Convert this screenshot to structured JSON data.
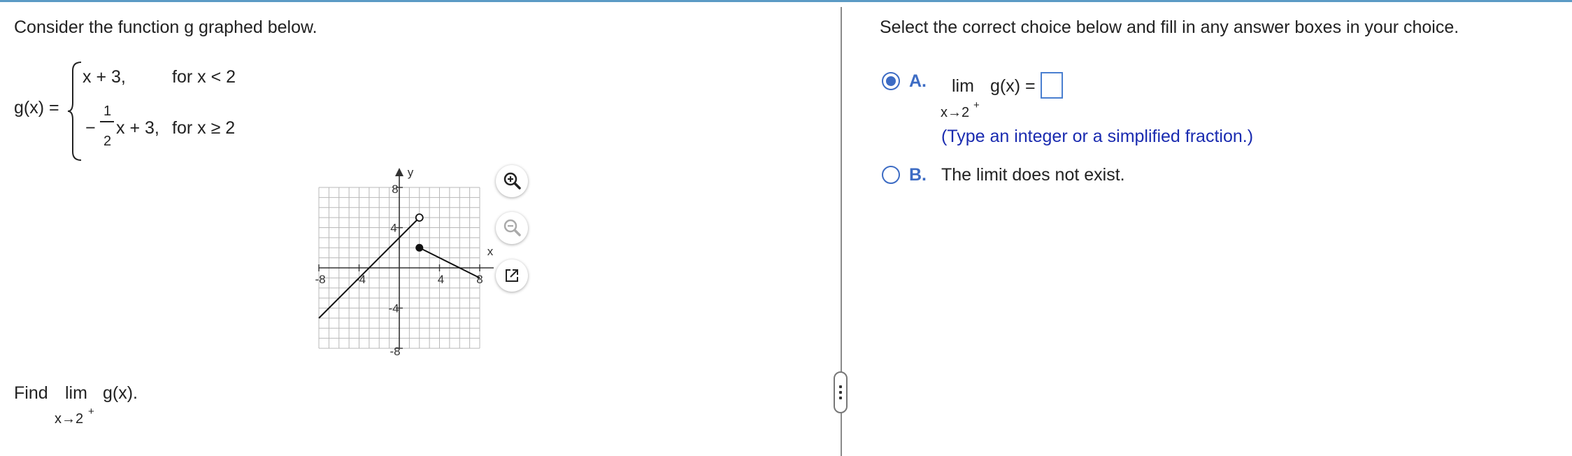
{
  "left": {
    "prompt": "Consider the function g graphed below.",
    "func_name": "g(x) =",
    "piece1": {
      "expr": "x + 3,",
      "cond": "for x < 2"
    },
    "piece2": {
      "minus": "−",
      "num": "1",
      "den": "2",
      "expr": "x + 3,",
      "cond": "for x ≥ 2"
    },
    "find": {
      "label": "Find",
      "lim": "lim",
      "func": "g(x).",
      "sub": "x→2",
      "sup": "+"
    }
  },
  "graph": {
    "y_label": "y",
    "x_label": "x",
    "ticks": {
      "neg8": "-8",
      "neg4": "-4",
      "pos4": "4",
      "pos8": "8"
    },
    "xlim": [
      -8,
      8
    ],
    "ylim": [
      -8,
      8
    ],
    "segments": [
      {
        "x1": -8,
        "y1": -5,
        "x2": 2,
        "y2": 5,
        "end": "open"
      },
      {
        "x1": 2,
        "y1": 2,
        "x2": 8,
        "y2": -1,
        "start": "closed"
      }
    ]
  },
  "tools": {
    "zoom_in": "zoom-in-icon",
    "zoom_out": "zoom-out-icon",
    "popout": "popout-icon"
  },
  "right": {
    "instruction": "Select the correct choice below and fill in any answer boxes in your choice.",
    "optionA": {
      "letter": "A.",
      "lim": "lim",
      "func": "g(x) =",
      "sub": "x→2",
      "sup": "+",
      "hint": "(Type an integer or a simplified fraction.)",
      "selected": true
    },
    "optionB": {
      "letter": "B.",
      "text": "The limit does not exist.",
      "selected": false
    }
  },
  "colors": {
    "accent": "#3d6cc4",
    "hint": "#1a2bb0",
    "topline": "#5b9bc5"
  }
}
